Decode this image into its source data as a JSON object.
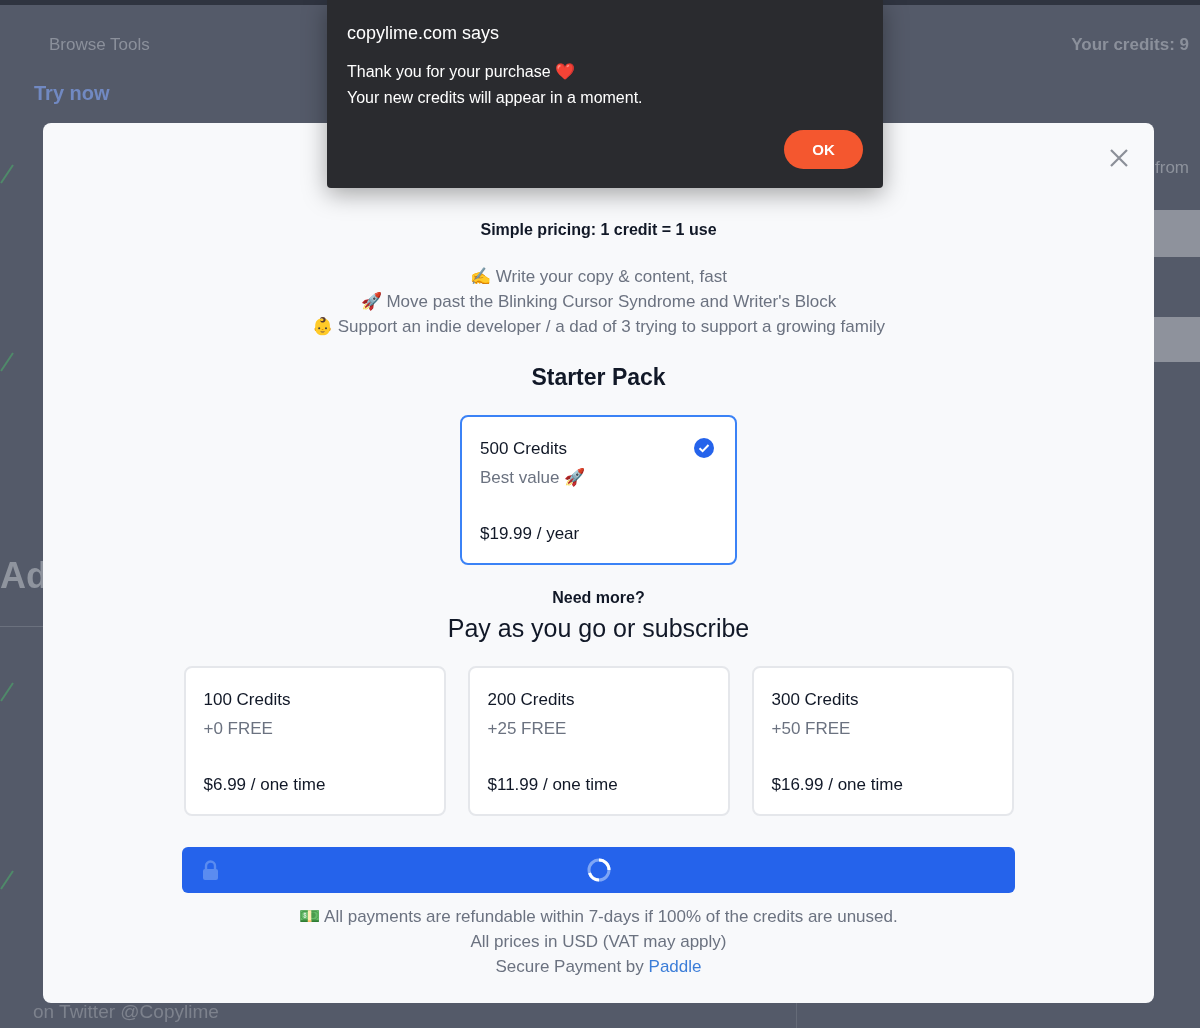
{
  "background_page": {
    "nav_link": "Browse Tools",
    "credits": "Your credits: 9",
    "try_link": "Try now",
    "right_text": "from",
    "section_heading": "Ad",
    "footer_line": "on Twitter @Copylime"
  },
  "modal": {
    "subtitle": "Simple pricing: 1 credit = 1 use",
    "bullets": [
      "✍️ Write your copy & content, fast",
      "🚀 Move past the Blinking Cursor Syndrome and Writer's Block",
      "👶 Support an indie developer / a dad of 3 trying to support a growing family"
    ],
    "starter_heading": "Starter Pack",
    "starter_plans": [
      {
        "name": "500 Credits",
        "note": "Best value 🚀",
        "price": "$19.99 / year",
        "selected": true
      }
    ],
    "more_label": "Need more?",
    "more_heading": "Pay as you go or subscribe",
    "plans": [
      {
        "name": "100 Credits",
        "note": "+0 FREE",
        "price": "$6.99 / one time",
        "selected": false
      },
      {
        "name": "200 Credits",
        "note": "+25 FREE",
        "price": "$11.99 / one time",
        "selected": false
      },
      {
        "name": "300 Credits",
        "note": "+50 FREE",
        "price": "$16.99 / one time",
        "selected": false
      }
    ],
    "pay_button": {
      "loading": true
    },
    "footer": [
      "💵 All payments are refundable within 7-days if 100% of the credits are unused.",
      "All prices in USD (VAT may apply)"
    ],
    "secure_text": "Secure Payment by",
    "secure_link": "Paddle"
  },
  "alert": {
    "title": "copylime.com says",
    "message": [
      "Thank you for your purchase ❤️",
      "Your new credits will appear in a moment."
    ],
    "button": "OK"
  }
}
